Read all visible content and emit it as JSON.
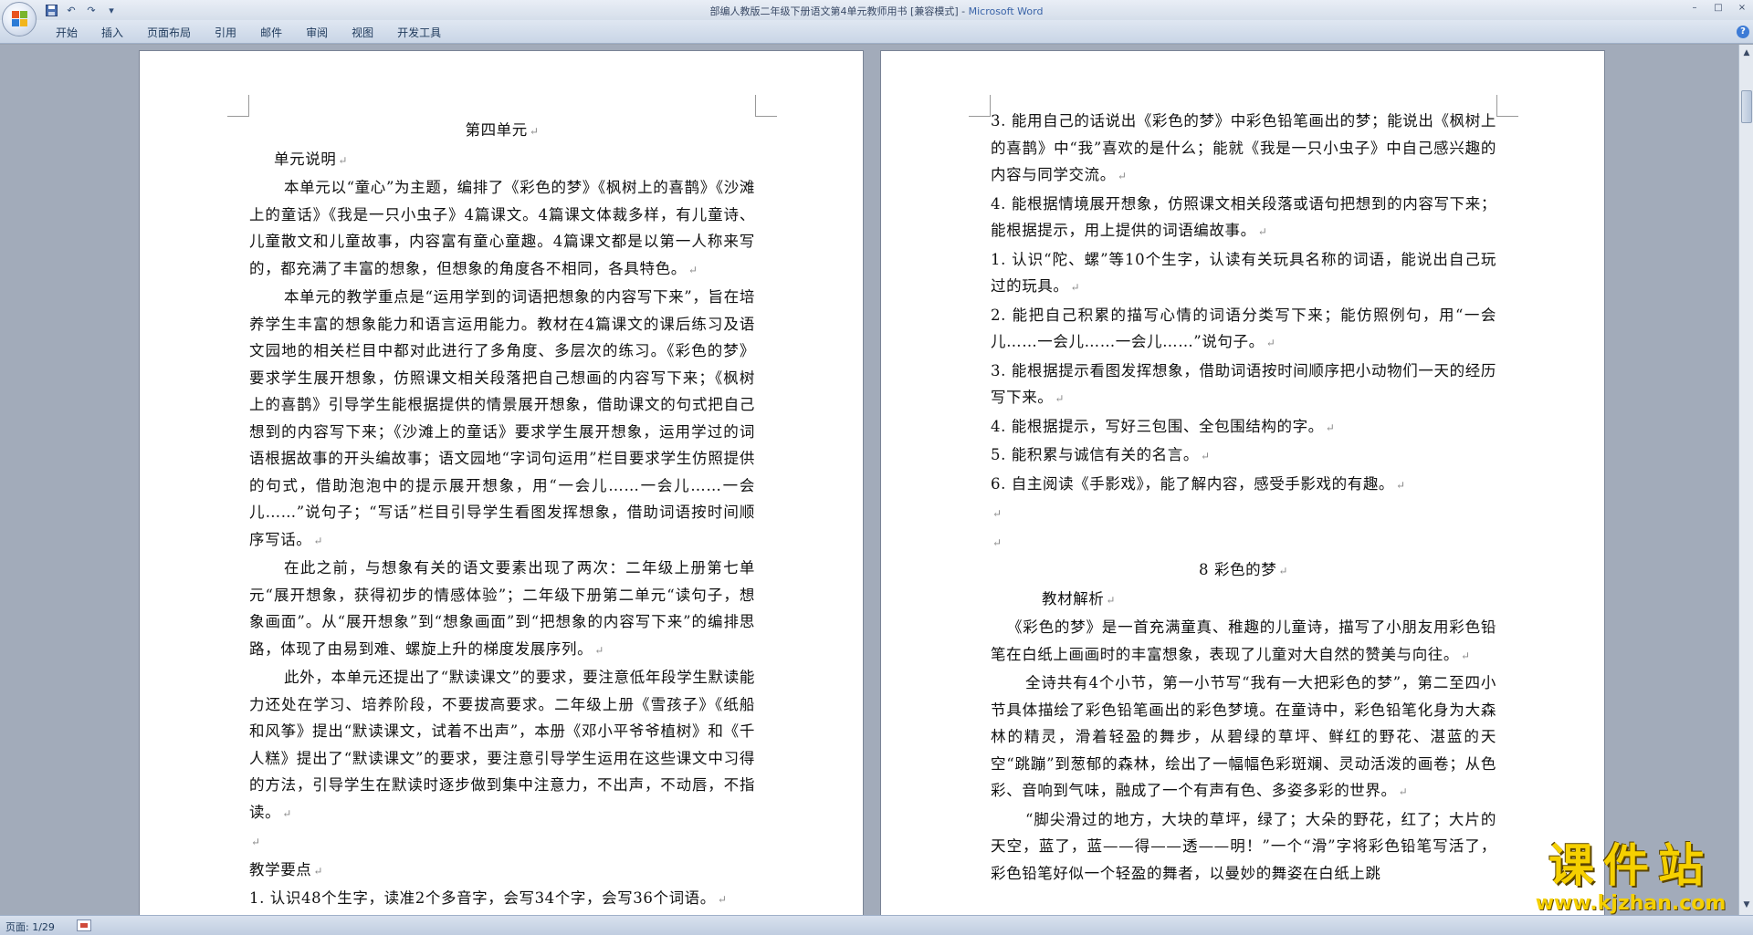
{
  "window": {
    "title": "部编人教版二年级下册语文第4单元教师用书 [兼容模式]",
    "title_separator": " - ",
    "app_name": "Microsoft Word",
    "controls": [
      "–",
      "□",
      "×"
    ]
  },
  "quick_access": {
    "save_icon": "save-icon",
    "undo_label": "↶",
    "redo_label": "↷",
    "more_label": "▾"
  },
  "ribbon": {
    "tabs": [
      "开始",
      "插入",
      "页面布局",
      "引用",
      "邮件",
      "审阅",
      "视图",
      "开发工具"
    ],
    "help_label": "?"
  },
  "page_left": {
    "heading": "第四单元",
    "subheading": "单元说明",
    "paragraphs": [
      "本单元以“童心”为主题，编排了《彩色的梦》《枫树上的喜鹊》《沙滩上的童话》《我是一只小虫子》4篇课文。4篇课文体裁多样，有儿童诗、儿童散文和儿童故事，内容富有童心童趣。4篇课文都是以第一人称来写的，都充满了丰富的想象，但想象的角度各不相同，各具特色。",
      "本单元的教学重点是“运用学到的词语把想象的内容写下来”，旨在培养学生丰富的想象能力和语言运用能力。教材在4篇课文的课后练习及语文园地的相关栏目中都对此进行了多角度、多层次的练习。《彩色的梦》要求学生展开想象，仿照课文相关段落把自己想画的内容写下来；《枫树上的喜鹊》引导学生能根据提供的情景展开想象，借助课文的句式把自己想到的内容写下来；《沙滩上的童话》要求学生展开想象，运用学过的词语根据故事的开头编故事；语文园地“字词句运用”栏目要求学生仿照提供的句式，借助泡泡中的提示展开想象，用“一会儿……一会儿……一会儿……”说句子；“写话”栏目引导学生看图发挥想象，借助词语按时间顺序写话。",
      "在此之前，与想象有关的语文要素出现了两次：二年级上册第七单元“展开想象，获得初步的情感体验”；二年级下册第二单元“读句子，想象画面”。从“展开想象”到“想象画面”到“把想象的内容写下来”的编排思路，体现了由易到难、螺旋上升的梯度发展序列。",
      "此外，本单元还提出了“默读课文”的要求，要注意低年段学生默读能力还处在学习、培养阶段，不要拔高要求。二年级上册《雪孩子》《纸船和风筝》提出“默读课文，试着不出声”，本册《邓小平爷爷植树》和《千人糕》提出了“默读课文”的要求，要注意引导学生运用在这些课文中习得的方法，引导学生在默读时逐步做到集中注意力，不出声，不动唇，不指读。"
    ],
    "section_title": "教学要点",
    "last_line": "1. 认识48个生字，读准2个多音字，会写34个字，会写36个词语。"
  },
  "page_right": {
    "lines": [
      "3. 能用自己的话说出《彩色的梦》中彩色铅笔画出的梦；能说出《枫树上的喜鹊》中“我”喜欢的是什么；能就《我是一只小虫子》中自己感兴趣的内容与同学交流。",
      "4. 能根据情境展开想象，仿照课文相关段落或语句把想到的内容写下来；能根据提示，用上提供的词语编故事。",
      "1. 认识“陀、螺”等10个生字，认读有关玩具名称的词语，能说出自己玩过的玩具。",
      "2. 能把自己积累的描写心情的词语分类写下来；能仿照例句，用“一会儿……一会儿……一会儿……”说句子。",
      "3. 能根据提示看图发挥想象，借助词语按时间顺序把小动物们一天的经历写下来。",
      "4. 能根据提示，写好三包围、全包围结构的字。",
      "5. 能积累与诚信有关的名言。",
      "6. 自主阅读《手影戏》，能了解内容，感受手影戏的有趣。"
    ],
    "lesson_title": "8 彩色的梦",
    "lesson_sub": "教材解析",
    "lesson_paragraphs": [
      "《彩色的梦》是一首充满童真、稚趣的儿童诗，描写了小朋友用彩色铅笔在白纸上画画时的丰富想象，表现了儿童对大自然的赞美与向往。",
      "全诗共有4个小节，第一小节写“我有一大把彩色的梦”，第二至四小节具体描绘了彩色铅笔画出的彩色梦境。在童诗中，彩色铅笔化身为大森林的精灵，滑着轻盈的舞步，从碧绿的草坪、鲜红的野花、湛蓝的天空“跳蹦”到葱郁的森林，绘出了一幅幅色彩斑斓、灵动活泼的画卷；从色彩、音响到气味，融成了一个有声有色、多姿多彩的世界。",
      "“脚尖滑过的地方，大块的草坪，绿了；大朵的野花，红了；大片的天空，蓝了，蓝——得——透——明！”一个“滑”字将彩色铅笔写活了，彩色铅笔好似一个轻盈的舞者，以曼妙的舞姿在白纸上跳"
    ]
  },
  "paragraph_mark": "↵",
  "status": {
    "page_label": "页面: 1/29"
  },
  "watermark": {
    "title": "课件站",
    "url": "www.kjzhan.com"
  },
  "scrollbar": {
    "up_label": "▲",
    "down_label": "▼"
  }
}
